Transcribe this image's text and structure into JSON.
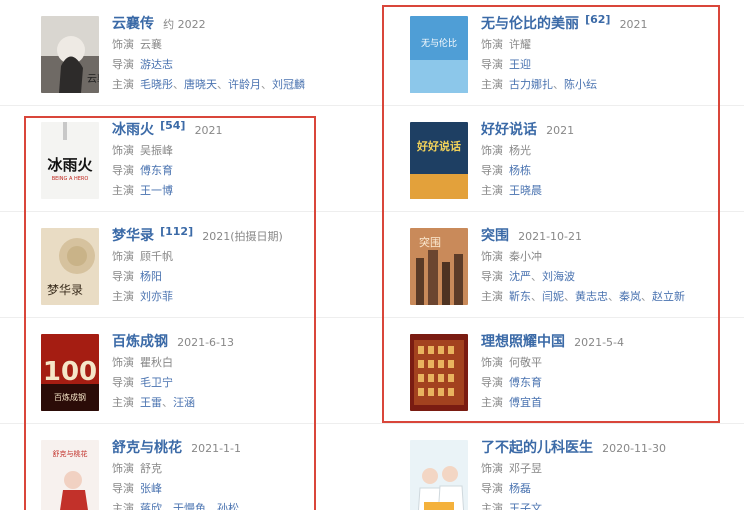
{
  "movies_left": [
    {
      "title": "云襄传",
      "date": "约 2022",
      "role_label": "饰演",
      "role": "云襄",
      "director_label": "导演",
      "directors": [
        "游达志"
      ],
      "cast_label": "主演",
      "cast": [
        "毛晓彤",
        "唐晓天",
        "许龄月",
        "刘冠麟"
      ]
    },
    {
      "title": "冰雨火",
      "count": "[54]",
      "date": "2021",
      "role_label": "饰演",
      "role": "吴振峰",
      "director_label": "导演",
      "directors": [
        "傅东育"
      ],
      "cast_label": "主演",
      "cast": [
        "王一博"
      ]
    },
    {
      "title": "梦华录",
      "count": "[112]",
      "date": "2021(拍摄日期)",
      "role_label": "饰演",
      "role": "顾千帆",
      "director_label": "导演",
      "directors": [
        "杨阳"
      ],
      "cast_label": "主演",
      "cast": [
        "刘亦菲"
      ]
    },
    {
      "title": "百炼成钢",
      "date": "2021-6-13",
      "role_label": "饰演",
      "role": "瞿秋白",
      "director_label": "导演",
      "directors": [
        "毛卫宁"
      ],
      "cast_label": "主演",
      "cast": [
        "王雷",
        "汪涵"
      ]
    },
    {
      "title": "舒克与桃花",
      "date": "2021-1-1",
      "role_label": "饰演",
      "role": "舒克",
      "director_label": "导演",
      "directors": [
        "张峰"
      ],
      "cast_label": "主演",
      "cast": [
        "蒋欣",
        "于慢鱼",
        "孙松"
      ]
    }
  ],
  "movies_right": [
    {
      "title": "无与伦比的美丽",
      "count": "[62]",
      "date": "2021",
      "role_label": "饰演",
      "role": "许耀",
      "director_label": "导演",
      "directors": [
        "王迎"
      ],
      "cast_label": "主演",
      "cast": [
        "古力娜扎",
        "陈小纭"
      ]
    },
    {
      "title": "好好说话",
      "date": "2021",
      "role_label": "饰演",
      "role": "杨光",
      "director_label": "导演",
      "directors": [
        "杨栋"
      ],
      "cast_label": "主演",
      "cast": [
        "王晓晨"
      ]
    },
    {
      "title": "突围",
      "date": "2021-10-21",
      "role_label": "饰演",
      "role": "秦小冲",
      "director_label": "导演",
      "directors": [
        "沈严",
        "刘海波"
      ],
      "cast_label": "主演",
      "cast": [
        "靳东",
        "闫妮",
        "黄志忠",
        "秦岚",
        "赵立新"
      ]
    },
    {
      "title": "理想照耀中国",
      "date": "2021-5-4",
      "role_label": "饰演",
      "role": "何敬平",
      "director_label": "导演",
      "directors": [
        "傅东育"
      ],
      "cast_label": "主演",
      "cast": [
        "傅宜首"
      ]
    },
    {
      "title": "了不起的儿科医生",
      "date": "2020-11-30",
      "role_label": "饰演",
      "role": "邓子昱",
      "director_label": "导演",
      "directors": [
        "杨磊"
      ],
      "cast_label": "主演",
      "cast": [
        "王子文"
      ]
    }
  ],
  "posters": {
    "binyuhuo_cn": "冰雨火",
    "binyuhuo_en": "BEING A HERO",
    "menghualu": "梦华录",
    "bailian_num": "100",
    "bailian_sub": "百炼成钢",
    "shuke": "舒克与桃花",
    "haohao": "好好说话",
    "wuyu": "无与伦比",
    "tuwei": "突围",
    "yunxiang": "云襄"
  },
  "colors": {
    "link": "#3b6aa7",
    "highlight": "#d9463a"
  }
}
